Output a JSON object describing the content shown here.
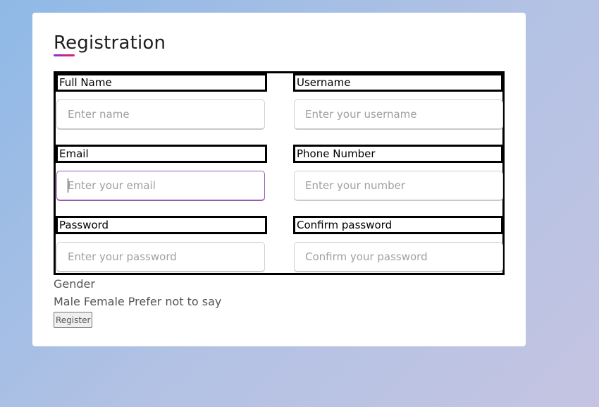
{
  "form": {
    "title": "Registration",
    "fields": [
      {
        "label": "Full Name",
        "placeholder": "Enter name",
        "value": ""
      },
      {
        "label": "Username",
        "placeholder": "Enter your username",
        "value": ""
      },
      {
        "label": "Email",
        "placeholder": "Enter your email",
        "value": ""
      },
      {
        "label": "Phone Number",
        "placeholder": "Enter your number",
        "value": ""
      },
      {
        "label": "Password",
        "placeholder": "Enter your password",
        "value": ""
      },
      {
        "label": "Confirm password",
        "placeholder": "Confirm your password",
        "value": ""
      }
    ],
    "gender": {
      "title": "Gender",
      "options": [
        "Male",
        "Female",
        "Prefer not to say"
      ]
    },
    "register_label": "Register"
  },
  "colors": {
    "background_start": "#8fb9e6",
    "background_end": "#c4c4e2",
    "accent_start": "#8e2de2",
    "accent_end": "#e0245e",
    "focus": "#9b59b6"
  }
}
